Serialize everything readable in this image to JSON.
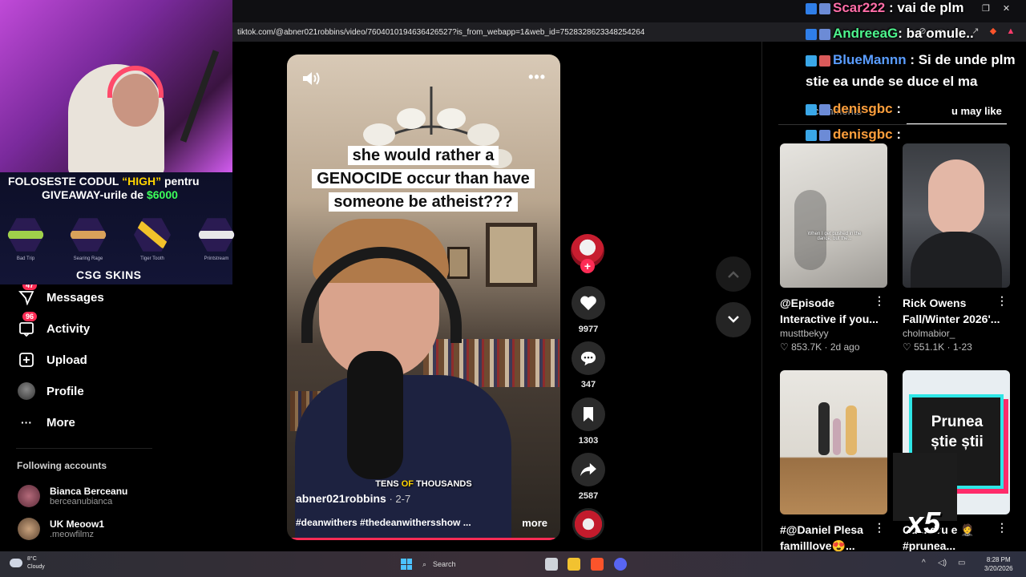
{
  "browser": {
    "url": "tiktok.com/@abner021robbins/video/7604010194636426527?is_from_webapp=1&web_id=7528328623348254264"
  },
  "stream_overlay": {
    "promo_line1_prefix": "FOLOSESTE CODUL ",
    "promo_code": "“HIGH”",
    "promo_line1_suffix": " pentru",
    "promo_line2_prefix": "GIVEAWAY-urile de ",
    "promo_amount": "$6000",
    "skins": [
      {
        "name": "Bad Trip",
        "color": "#9fd04a"
      },
      {
        "name": "Searing Rage",
        "color": "#d9a15a"
      },
      {
        "name": "Tiger Tooth",
        "color": "#f2c22a"
      },
      {
        "name": "Printstream",
        "color": "#e8e8e8"
      }
    ],
    "brand": "CSG SKINS"
  },
  "chat": [
    {
      "user": "Scar222",
      "message": " : vai de plm",
      "color_class": "u3"
    },
    {
      "user": "AndreeaG",
      "message": ": ba omule..",
      "color_class": "u2"
    },
    {
      "user": "BlueMannn",
      "message": " : Si de unde plm",
      "color_class": "u3"
    },
    {
      "user": "",
      "message": "stie ea unde se duce el ma",
      "color_class": "u3"
    },
    {
      "user": "denisgbc",
      "message": " :",
      "color_class": "u4"
    },
    {
      "user": "denisgbc",
      "message": " :",
      "color_class": "u4"
    }
  ],
  "sidebar": {
    "items": [
      {
        "label": "Messages",
        "badge": "47",
        "icon": "messages-icon"
      },
      {
        "label": "Activity",
        "badge": "96",
        "icon": "activity-icon"
      },
      {
        "label": "Upload",
        "badge": "",
        "icon": "upload-icon"
      },
      {
        "label": "Profile",
        "badge": "",
        "icon": "profile-icon"
      },
      {
        "label": "More",
        "badge": "",
        "icon": "more-icon"
      }
    ],
    "following_title": "Following accounts",
    "accounts": [
      {
        "name": "Bianca Berceanu",
        "handle": "berceanubianca"
      },
      {
        "name": "UK Meoow1",
        "handle": ".meowfilmz"
      }
    ]
  },
  "video": {
    "caption_lines": [
      "she would rather a",
      "GENOCIDE occur than have",
      "someone be atheist???"
    ],
    "subtitle_a": "TENS ",
    "subtitle_b": "OF",
    "subtitle_c": " THOUSANDS",
    "author": "abner021robbins",
    "date": " · 2-7",
    "tags": "#deanwithers #thedeanwithersshow ...",
    "more_label": "more",
    "progress": 0.98
  },
  "actions": {
    "likes": "9977",
    "comments": "347",
    "saves": "1303",
    "shares": "2587"
  },
  "right_panel": {
    "tab_comments": "comments",
    "tab_may_like": "u may like",
    "cards": [
      {
        "title": "@Episode",
        "title2": "Interactive if you...",
        "user": "musttbekyy",
        "likes": "853.7K",
        "date": "2d ago"
      },
      {
        "title": "Rick Owens",
        "title2": "Fall/Winter 2026'...",
        "user": "cholmabior_",
        "likes": "551.1K",
        "date": "1-23"
      },
      {
        "title": "#@Daniel Plesa",
        "title2": "familllove😍...",
        "user": "",
        "likes": "",
        "date": ""
      },
      {
        "title": "Cu ...dru e 🤵",
        "title2": "#prunea...",
        "user": "",
        "likes": "",
        "date": ""
      }
    ],
    "card1_thumb_text": "When I get pushed in the dance, but the...",
    "card4_thumb_text": "Prunea știe știi",
    "multiplier": "x5"
  },
  "taskbar": {
    "temp": "8°C",
    "weather": "Cloudy",
    "search": "Search",
    "time": "8:28 PM",
    "date": "3/20/2026"
  }
}
